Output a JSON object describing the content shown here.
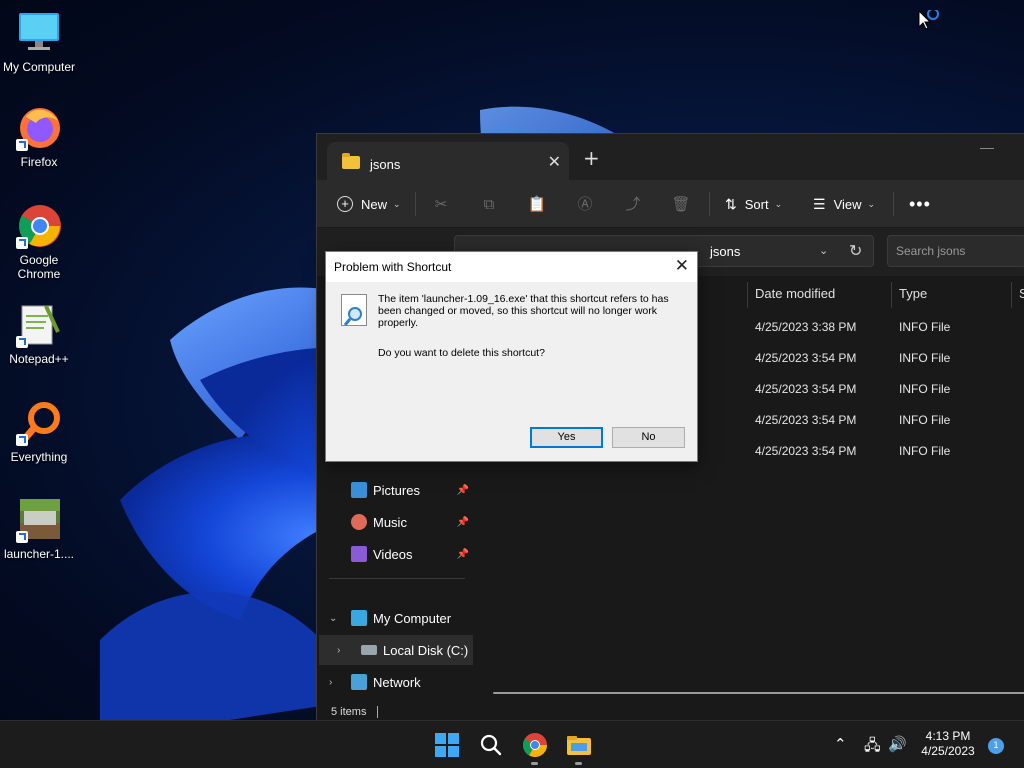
{
  "desktop": {
    "icons": [
      {
        "label": "My Computer"
      },
      {
        "label": "Firefox"
      },
      {
        "label": "Google Chrome"
      },
      {
        "label": "Notepad++"
      },
      {
        "label": "Everything"
      },
      {
        "label": "launcher-1...."
      }
    ]
  },
  "explorer": {
    "tab_title": "jsons",
    "toolbar": {
      "new_label": "New",
      "sort_label": "Sort",
      "view_label": "View"
    },
    "address": {
      "crumb": "jsons"
    },
    "search": {
      "placeholder": "Search jsons"
    },
    "nav": {
      "pictures": "Pictures",
      "music": "Music",
      "videos": "Videos",
      "my_computer": "My Computer",
      "local_disk": "Local Disk (C:)",
      "network": "Network"
    },
    "columns": {
      "date_modified": "Date modified",
      "type": "Type",
      "size": "S"
    },
    "files": [
      {
        "date": "4/25/2023 3:38 PM",
        "type": "INFO File"
      },
      {
        "date": "4/25/2023 3:54 PM",
        "type": "INFO File"
      },
      {
        "date": "4/25/2023 3:54 PM",
        "type": "INFO File"
      },
      {
        "date": "4/25/2023 3:54 PM",
        "type": "INFO File"
      },
      {
        "date": "4/25/2023 3:54 PM",
        "type": "INFO File"
      }
    ],
    "status": "5 items"
  },
  "dialog": {
    "title": "Problem with Shortcut",
    "message": "The item 'launcher-1.09_16.exe' that this shortcut refers to has been changed or moved, so this shortcut will no longer work properly.",
    "question": "Do you want to delete this shortcut?",
    "yes_label": "Yes",
    "no_label": "No"
  },
  "taskbar": {
    "time": "4:13 PM",
    "date": "4/25/2023",
    "notification_count": "1"
  },
  "colors": {
    "accent": "#0078d7",
    "folder": "#f3c13a",
    "explorer_bg": "#191919",
    "dialog_bg": "#f0f0f0"
  },
  "icons": [
    "monitor-icon",
    "firefox-icon",
    "chrome-icon",
    "notepadpp-icon",
    "everything-icon",
    "minecraft-icon",
    "folder-icon",
    "search-icon",
    "windows-start-icon",
    "file-explorer-icon"
  ]
}
